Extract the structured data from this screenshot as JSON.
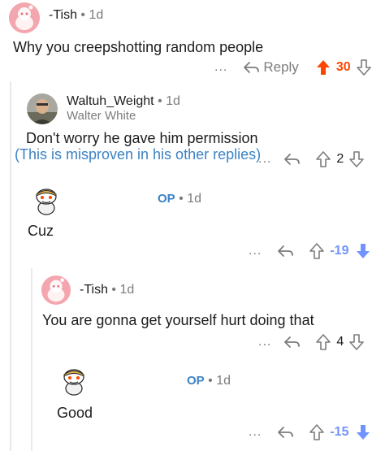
{
  "comments": [
    {
      "username": "-Tish",
      "time": "1d",
      "body": "Why you creepshotting random people",
      "reply_label": "Reply",
      "score": "30",
      "vote_state": "upvoted",
      "more": "..."
    },
    {
      "username": "Waltuh_Weight",
      "flair": "Walter White",
      "time": "1d",
      "body": "Don't worry he gave him permission",
      "note": "(This is misproven in his other replies)",
      "score": "2",
      "vote_state": "none",
      "more": "..."
    },
    {
      "op_label": "OP",
      "time": "1d",
      "body": "Cuz",
      "score": "-19",
      "vote_state": "downvoted",
      "more": "..."
    },
    {
      "username": "-Tish",
      "time": "1d",
      "body": "You are gonna get yourself hurt doing that",
      "score": "4",
      "vote_state": "none",
      "more": "..."
    },
    {
      "op_label": "OP",
      "time": "1d",
      "body": "Good",
      "score": "-15",
      "vote_state": "downvoted",
      "more": "..."
    }
  ],
  "separator": "•",
  "colors": {
    "upvote": "#ff4500",
    "downvote": "#7193ff",
    "note_blue": "#3b82c4",
    "muted": "#7c7c7c",
    "thread_line": "#e9e9e9",
    "tish_avatar_bg": "#f3a6ad"
  }
}
